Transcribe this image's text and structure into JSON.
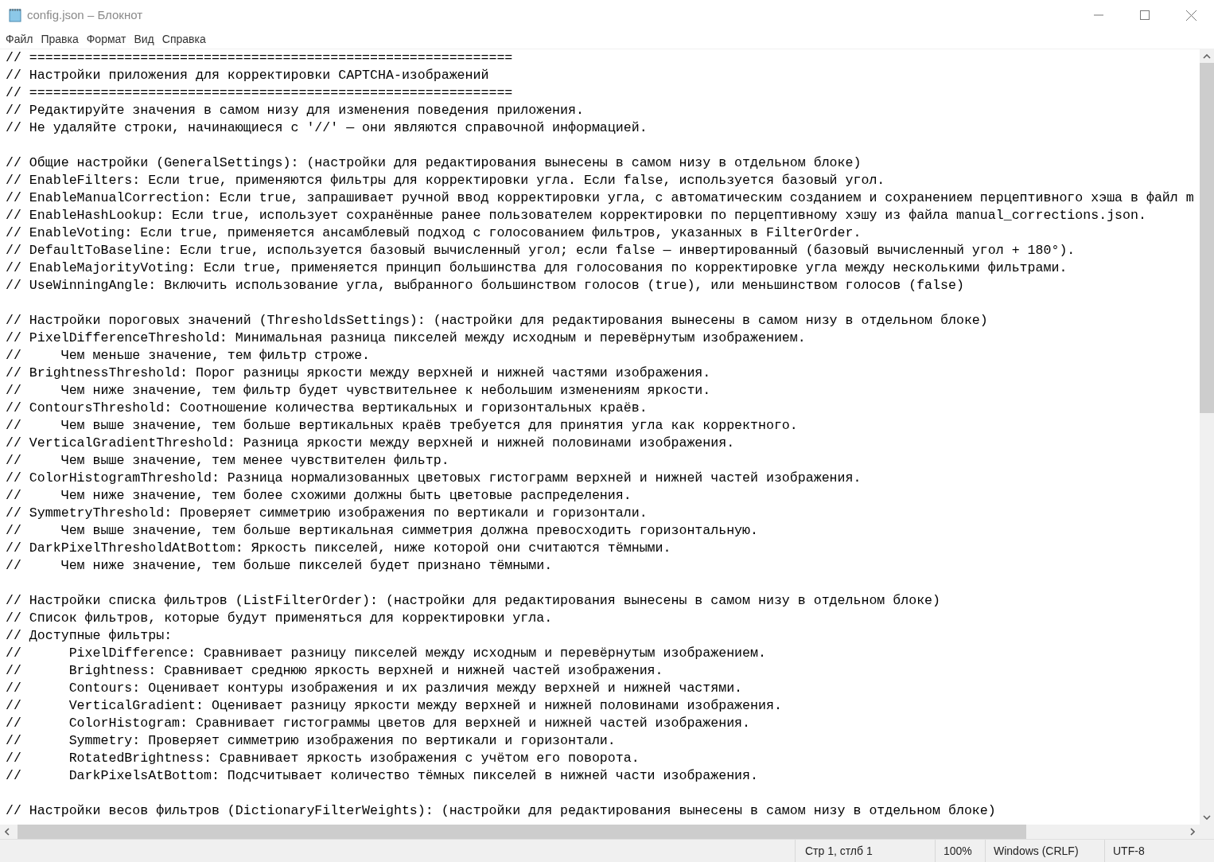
{
  "window": {
    "title": "config.json – Блокнот"
  },
  "menu": [
    "Файл",
    "Правка",
    "Формат",
    "Вид",
    "Справка"
  ],
  "editor": {
    "lines": [
      {
        "kind": "text",
        "text": "// ============================================================="
      },
      {
        "kind": "text",
        "text": "// Настройки приложения для корректировки CAPTCHA-изображений"
      },
      {
        "kind": "text",
        "text": "// ============================================================="
      },
      {
        "kind": "text",
        "text": "// Редактируйте значения в самом низу для изменения поведения приложения."
      },
      {
        "kind": "text",
        "text": "// Не удаляйте строки, начинающиеся с '//' — они являются справочной информацией."
      },
      {
        "kind": "blank"
      },
      {
        "kind": "text",
        "text": "// Общие настройки (GeneralSettings): (настройки для редактирования вынесены в самом низу в отдельном блоке)"
      },
      {
        "kind": "text",
        "text": "// EnableFilters: Если true, применяются фильтры для корректировки угла. Если false, используется базовый угол."
      },
      {
        "kind": "text",
        "text": "// EnableManualCorrection: Если true, запрашивает ручной ввод корректировки угла, с автоматическим созданием и сохранением перцептивного хэша в файл m"
      },
      {
        "kind": "text",
        "text": "// EnableHashLookup: Если true, использует сохранённые ранее пользователем корректировки по перцептивному хэшу из файла manual_corrections.json."
      },
      {
        "kind": "text",
        "text": "// EnableVoting: Если true, применяется ансамблевый подход с голосованием фильтров, указанных в FilterOrder."
      },
      {
        "kind": "text",
        "text": "// DefaultToBaseline: Если true, используется базовый вычисленный угол; если false — инвертированный (базовый вычисленный угол + 180°)."
      },
      {
        "kind": "text",
        "text": "// EnableMajorityVoting: Если true, применяется принцип большинства для голосования по корректировке угла между несколькими фильтрами."
      },
      {
        "kind": "text",
        "text": "// UseWinningAngle: Включить использование угла, выбранного большинством голосов (true), или меньшинством голосов (false)"
      },
      {
        "kind": "blank"
      },
      {
        "kind": "text",
        "text": "// Настройки пороговых значений (ThresholdsSettings): (настройки для редактирования вынесены в самом низу в отдельном блоке)"
      },
      {
        "kind": "text",
        "text": "// PixelDifferenceThreshold: Минимальная разница пикселей между исходным и перевёрнутым изображением."
      },
      {
        "kind": "text",
        "text": "//     Чем меньше значение, тем фильтр строже."
      },
      {
        "kind": "text",
        "text": "// BrightnessThreshold: Порог разницы яркости между верхней и нижней частями изображения."
      },
      {
        "kind": "text",
        "text": "//     Чем ниже значение, тем фильтр будет чувствительнее к небольшим изменениям яркости."
      },
      {
        "kind": "text",
        "text": "// ContoursThreshold: Соотношение количества вертикальных и горизонтальных краёв."
      },
      {
        "kind": "text",
        "text": "//     Чем выше значение, тем больше вертикальных краёв требуется для принятия угла как корректного."
      },
      {
        "kind": "text",
        "text": "// VerticalGradientThreshold: Разница яркости между верхней и нижней половинами изображения."
      },
      {
        "kind": "text",
        "text": "//     Чем выше значение, тем менее чувствителен фильтр."
      },
      {
        "kind": "text",
        "text": "// ColorHistogramThreshold: Разница нормализованных цветовых гистограмм верхней и нижней частей изображения."
      },
      {
        "kind": "text",
        "text": "//     Чем ниже значение, тем более схожими должны быть цветовые распределения."
      },
      {
        "kind": "text",
        "text": "// SymmetryThreshold: Проверяет симметрию изображения по вертикали и горизонтали."
      },
      {
        "kind": "text",
        "text": "//     Чем выше значение, тем больше вертикальная симметрия должна превосходить горизонтальную."
      },
      {
        "kind": "text",
        "text": "// DarkPixelThresholdAtBottom: Яркость пикселей, ниже которой они считаются тёмными."
      },
      {
        "kind": "text",
        "text": "//     Чем ниже значение, тем больше пикселей будет признано тёмными."
      },
      {
        "kind": "blank"
      },
      {
        "kind": "text",
        "text": "// Настройки списка фильтров (ListFilterOrder): (настройки для редактирования вынесены в самом низу в отдельном блоке)"
      },
      {
        "kind": "text",
        "text": "// Список фильтров, которые будут применяться для корректировки угла."
      },
      {
        "kind": "text",
        "text": "// Доступные фильтры:"
      },
      {
        "kind": "text",
        "text": "//      PixelDifference: Сравнивает разницу пикселей между исходным и перевёрнутым изображением."
      },
      {
        "kind": "text",
        "text": "//      Brightness: Сравнивает среднюю яркость верхней и нижней частей изображения."
      },
      {
        "kind": "text",
        "text": "//      Contours: Оценивает контуры изображения и их различия между верхней и нижней частями."
      },
      {
        "kind": "text",
        "text": "//      VerticalGradient: Оценивает разницу яркости между верхней и нижней половинами изображения."
      },
      {
        "kind": "text",
        "text": "//      ColorHistogram: Сравнивает гистограммы цветов для верхней и нижней частей изображения."
      },
      {
        "kind": "text",
        "text": "//      Symmetry: Проверяет симметрию изображения по вертикали и горизонтали."
      },
      {
        "kind": "text",
        "text": "//      RotatedBrightness: Сравнивает яркость изображения с учётом его поворота."
      },
      {
        "kind": "text",
        "text": "//      DarkPixelsAtBottom: Подсчитывает количество тёмных пикселей в нижней части изображения."
      },
      {
        "kind": "blank"
      },
      {
        "kind": "text",
        "text": "// Настройки весов фильтров (DictionaryFilterWeights): (настройки для редактирования вынесены в самом низу в отдельном блоке)"
      }
    ]
  },
  "status_bar": {
    "position": "Стр 1, стлб 1",
    "zoom": "100%",
    "line_endings": "Windows (CRLF)",
    "encoding": "UTF-8"
  }
}
